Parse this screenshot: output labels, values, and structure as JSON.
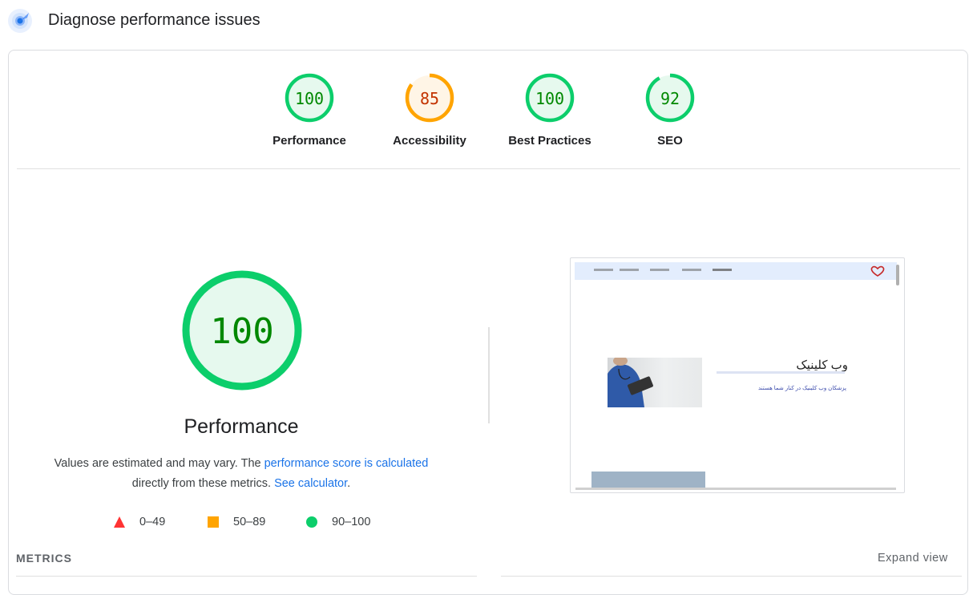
{
  "header": {
    "title": "Diagnose performance issues",
    "icon": "lighthouse-icon"
  },
  "gauges": [
    {
      "label": "Performance",
      "score": "100",
      "value": 100,
      "status": "pass"
    },
    {
      "label": "Accessibility",
      "score": "85",
      "value": 85,
      "status": "average"
    },
    {
      "label": "Best Practices",
      "score": "100",
      "value": 100,
      "status": "pass"
    },
    {
      "label": "SEO",
      "score": "92",
      "value": 92,
      "status": "pass"
    }
  ],
  "colors": {
    "pass": "#0cce6b",
    "pass_text": "#008800",
    "pass_bg": "#e6f9ee",
    "average": "#ffa400",
    "average_text": "#c33300",
    "average_bg": "#fff5e6",
    "fail": "#ff3333",
    "link": "#1a73e8"
  },
  "performance": {
    "score": "100",
    "title": "Performance",
    "desc_prefix": "Values are estimated and may vary. The ",
    "desc_link1": "performance score is calculated",
    "desc_middle": " directly from these metrics. ",
    "desc_link2": "See calculator",
    "desc_suffix": "."
  },
  "legend": [
    {
      "range": "0–49",
      "shape": "triangle",
      "color": "#ff3333"
    },
    {
      "range": "50–89",
      "shape": "square",
      "color": "#ffa400"
    },
    {
      "range": "90–100",
      "shape": "circle",
      "color": "#0cce6b"
    }
  ],
  "screenshot": {
    "brand": "وب کلینیک",
    "tagline": "پزشکان وب کلینیک در کنار شما هستند"
  },
  "metrics": {
    "title": "METRICS",
    "expand_label": "Expand view"
  }
}
